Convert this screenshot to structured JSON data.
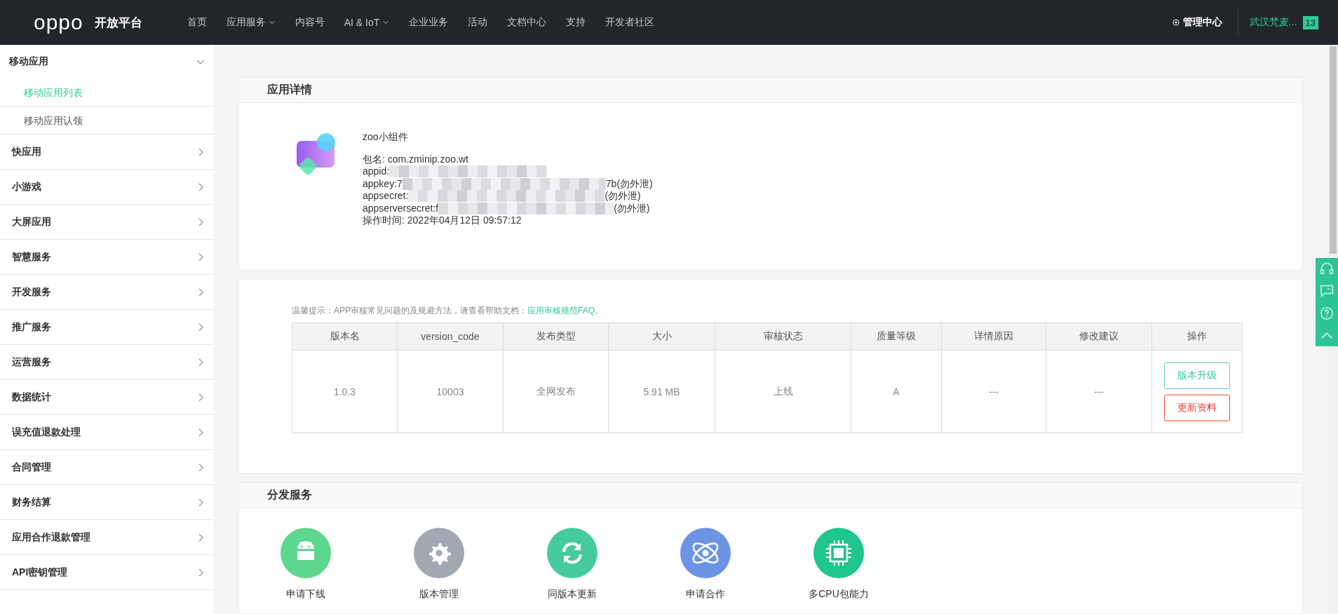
{
  "header": {
    "logo": "oppo",
    "platform": "开放平台",
    "nav": [
      {
        "label": "首页",
        "dropdown": false
      },
      {
        "label": "应用服务",
        "dropdown": true
      },
      {
        "label": "内容号",
        "dropdown": false
      },
      {
        "label": "AI & IoT",
        "dropdown": true
      },
      {
        "label": "企业业务",
        "dropdown": false
      },
      {
        "label": "活动",
        "dropdown": false
      },
      {
        "label": "文档中心",
        "dropdown": false
      },
      {
        "label": "支持",
        "dropdown": false
      },
      {
        "label": "开发者社区",
        "dropdown": false
      }
    ],
    "admin": "管理中心",
    "user": "武汉梵麦...",
    "badge": "13"
  },
  "sidebar": {
    "items": [
      {
        "label": "移动应用",
        "expanded": true,
        "children": [
          {
            "label": "移动应用列表",
            "selected": true
          },
          {
            "label": "移动应用认领",
            "selected": false
          }
        ]
      },
      {
        "label": "快应用",
        "expanded": false
      },
      {
        "label": "小游戏",
        "expanded": false
      },
      {
        "label": "大屏应用",
        "expanded": false
      },
      {
        "label": "智慧服务",
        "expanded": false
      },
      {
        "label": "开发服务",
        "expanded": false
      },
      {
        "label": "推广服务",
        "expanded": false
      },
      {
        "label": "运营服务",
        "expanded": false
      },
      {
        "label": "数据统计",
        "expanded": false
      },
      {
        "label": "误充值退款处理",
        "expanded": false
      },
      {
        "label": "合同管理",
        "expanded": false
      },
      {
        "label": "财务结算",
        "expanded": false
      },
      {
        "label": "应用合作退款管理",
        "expanded": false
      },
      {
        "label": "API密钥管理",
        "expanded": false
      }
    ]
  },
  "details": {
    "title": "应用详情",
    "app_name": "zoo小组件",
    "fields": [
      {
        "start": "包名: com.zminip.zoo.wt",
        "redacted": false
      },
      {
        "start": "appid:",
        "redacted": true
      },
      {
        "start": "appkey:7",
        "redacted": true,
        "end": "7b(勿外泄)"
      },
      {
        "start": "appsecret:",
        "redacted": true,
        "end": "(勿外泄)"
      },
      {
        "start": "appserversecret:f",
        "redacted": true,
        "end": "(勿外泄)"
      },
      {
        "start": "操作时间: 2022年04月12日 09:57:12",
        "redacted": false
      }
    ]
  },
  "versions": {
    "tip": "温馨提示：APP审核常见问题的及规避方法，请查看帮助文档：",
    "tip_link": "应用审核规范FAQ",
    "tip_end": "。",
    "columns": [
      "版本名",
      "version_code",
      "发布类型",
      "大小",
      "审核状态",
      "质量等级",
      "详情原因",
      "修改建议",
      "操作"
    ],
    "rows": [
      {
        "cells": [
          "1.0.3",
          "10003",
          "全网发布",
          "5.91 MB",
          "上线",
          "A",
          "---",
          "---"
        ],
        "actions": [
          {
            "label": "版本升级",
            "kind": "primary"
          },
          {
            "label": "更新资料",
            "kind": "danger"
          }
        ]
      }
    ]
  },
  "services": {
    "title": "分发服务",
    "items": [
      {
        "label": "申请下线",
        "kind": "android",
        "color": "#5dd68f"
      },
      {
        "label": "版本管理",
        "kind": "gear",
        "color": "#a2a8b1"
      },
      {
        "label": "同版本更新",
        "kind": "refresh",
        "color": "#46cc9c"
      },
      {
        "label": "申请合作",
        "kind": "atom",
        "color": "#6b95e4"
      },
      {
        "label": "多CPU包能力",
        "kind": "chip",
        "color": "#1fc68e"
      }
    ]
  }
}
